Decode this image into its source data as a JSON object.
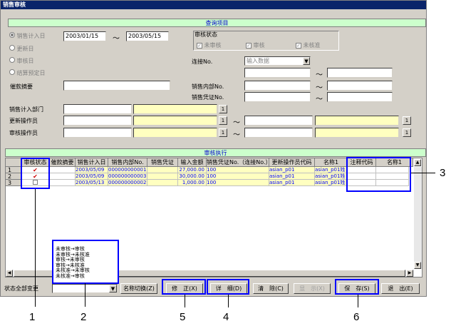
{
  "window": {
    "title": "销售审核"
  },
  "query_section": {
    "title": "查询项目"
  },
  "date_options": [
    {
      "label": "销售计入日",
      "selected": true
    },
    {
      "label": "更新日",
      "selected": false
    },
    {
      "label": "审核日",
      "selected": false
    },
    {
      "label": "结算预定日",
      "selected": false
    }
  ],
  "date_from": "2003/01/15",
  "date_tilde": "～",
  "date_to": "2003/05/15",
  "review_status": {
    "label": "审核状态",
    "options": [
      "未审核",
      "审核",
      "未核准"
    ]
  },
  "fields": {
    "collection_summary": "催款摘要",
    "connect_no": "连接No.",
    "connect_no_placeholder": "输入数据",
    "sales_internal_no": "销售内部No.",
    "sales_voucher_no": "销售凭证No.",
    "sales_dept": "销售计入部门",
    "update_operator": "更新操作员",
    "review_operator": "审核操作员",
    "lookup": "1",
    "tilde": "～"
  },
  "exec_section": {
    "title": "审核执行"
  },
  "table": {
    "headers": [
      "审核状态",
      "催款摘要",
      "销售计入日",
      "销售内部No.",
      "销售凭证",
      "输入金额",
      "销售凭证No.（连接No.）",
      "更新操作员代码",
      "名称1",
      "注释代码",
      "名称1"
    ],
    "rows": [
      {
        "no": "1",
        "check": "✔",
        "date": "2003/05/09",
        "internal": "000000000001",
        "amount": "27,000.00",
        "voucher": "100",
        "op": "asian_p01",
        "name": "asian_p01姓"
      },
      {
        "no": "2",
        "check": "✔",
        "date": "2003/05/09",
        "internal": "000000000003",
        "amount": "30,000.00",
        "voucher": "100",
        "op": "asian_p01",
        "name": "asian_p01姓"
      },
      {
        "no": "3",
        "check": "",
        "date": "2003/05/13",
        "internal": "000000000002",
        "amount": "1,000.00",
        "voucher": "100",
        "op": "asian_p01",
        "name": "asian_p01姓"
      }
    ]
  },
  "status_dropdown": {
    "options": [
      "未审核→审核",
      "未审核→未核准",
      "审核→未审核",
      "审核→未核准",
      "未核准→未审核",
      "未核准→审核"
    ]
  },
  "bottom": {
    "status_all_change": "状态全部变更",
    "buttons": [
      "名称切换(Z)",
      "修　正(X)",
      "详　细(D)",
      "清　除(C)",
      "显　示(X)",
      "保　存(S)",
      "退　出(E)"
    ]
  },
  "callouts": [
    "1",
    "2",
    "3",
    "4",
    "5",
    "6"
  ]
}
